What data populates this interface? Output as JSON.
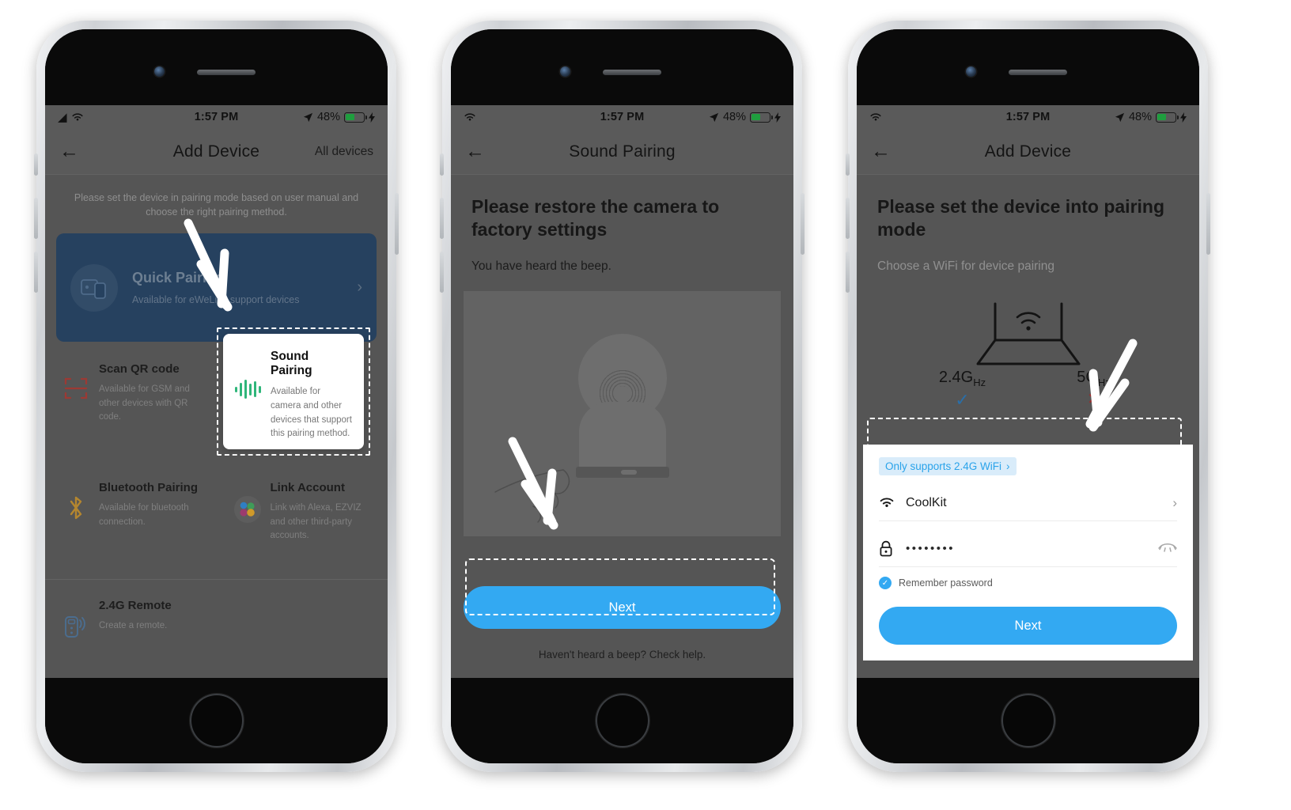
{
  "statusbar": {
    "time": "1:57 PM",
    "battery_pct": "48%",
    "wifi_icon": "wifi-icon",
    "location_icon": "location-arrow-icon",
    "charging_icon": "bolt-icon"
  },
  "colors": {
    "accent_blue": "#33a9f2",
    "quick_card": "#26415f",
    "screen_bg": "#555555",
    "check_blue": "#2a6ea8",
    "cross_red": "#9c2c2c",
    "sound_green": "#2fb67a"
  },
  "phone1": {
    "nav": {
      "back_icon": "arrow-left-icon",
      "title": "Add Device",
      "right_action": "All devices"
    },
    "hint": "Please set the device in pairing mode based on user manual and choose the right pairing method.",
    "quick_pairing": {
      "title": "Quick Pairing",
      "subtitle": "Available for eWeLink support devices",
      "icon": "devices-pair-icon",
      "chevron": "chevron-right-icon"
    },
    "options": [
      {
        "title": "Scan QR code",
        "desc": "Available for GSM and other devices with QR code.",
        "icon": "qr-scan-icon"
      },
      {
        "title": "Sound Pairing",
        "desc": "Available for camera and other devices that support this pairing method.",
        "icon": "sound-wave-icon"
      },
      {
        "title": "Bluetooth Pairing",
        "desc": "Available for bluetooth connection.",
        "icon": "bluetooth-icon"
      },
      {
        "title": "Link Account",
        "desc": "Link with Alexa, EZVIZ and other third-party accounts.",
        "icon": "link-account-icon"
      },
      {
        "title": "2.4G Remote",
        "desc": "Create a remote.",
        "icon": "remote-control-icon"
      }
    ]
  },
  "phone2": {
    "nav": {
      "back_icon": "arrow-left-icon",
      "title": "Sound Pairing"
    },
    "heading": "Please restore the camera to factory settings",
    "subtext": "You have heard the beep.",
    "illustration": "camera-reset-illustration",
    "next_label": "Next",
    "help_text": "Haven't heard a beep? Check help."
  },
  "phone3": {
    "nav": {
      "back_icon": "arrow-left-icon",
      "title": "Add Device"
    },
    "heading": "Please set the device into pairing mode",
    "subtext": "Choose a WiFi for device pairing",
    "router_icon": "wifi-router-icon",
    "freq": [
      {
        "label": "2.4G",
        "unit": "Hz",
        "mark": "✓",
        "supported": true
      },
      {
        "label": "5G",
        "unit": "Hz",
        "mark": "✕",
        "supported": false
      }
    ],
    "panel": {
      "badge": "Only supports 2.4G WiFi",
      "badge_chevron": "chevron-right-icon",
      "ssid_icon": "wifi-icon",
      "ssid_value": "CoolKit",
      "ssid_chevron": "chevron-right-icon",
      "password_icon": "lock-icon",
      "password_value": "••••••••",
      "password_toggle_icon": "eye-off-icon",
      "remember_label": "Remember password",
      "remember_checked": true,
      "next_label": "Next"
    }
  }
}
